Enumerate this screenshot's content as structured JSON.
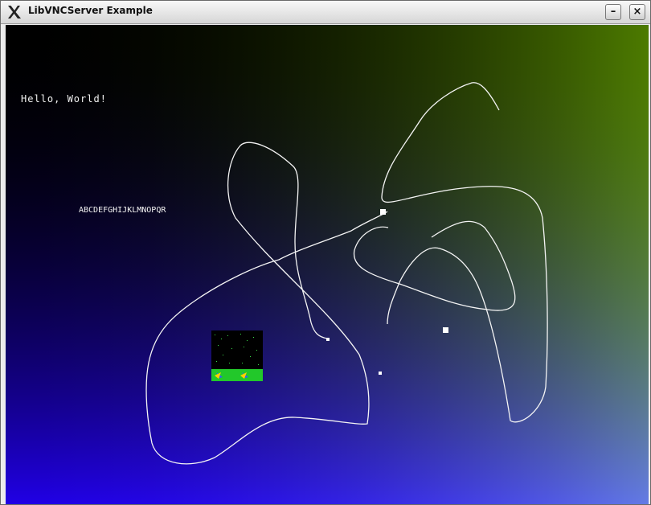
{
  "window": {
    "title": "LibVNCServer Example",
    "minimize_label": "–",
    "close_label": "×"
  },
  "canvas": {
    "hello_text": "Hello, World!",
    "alphabet_text": "ABCDEFGHIJKLMNOPQR",
    "gradient_colors": {
      "top_left": "#050510",
      "top_right": "#4a8a10",
      "bottom_left": "#2a00ff",
      "bottom_right": "#8a88ff"
    },
    "stroke_color": "#ffffff"
  }
}
